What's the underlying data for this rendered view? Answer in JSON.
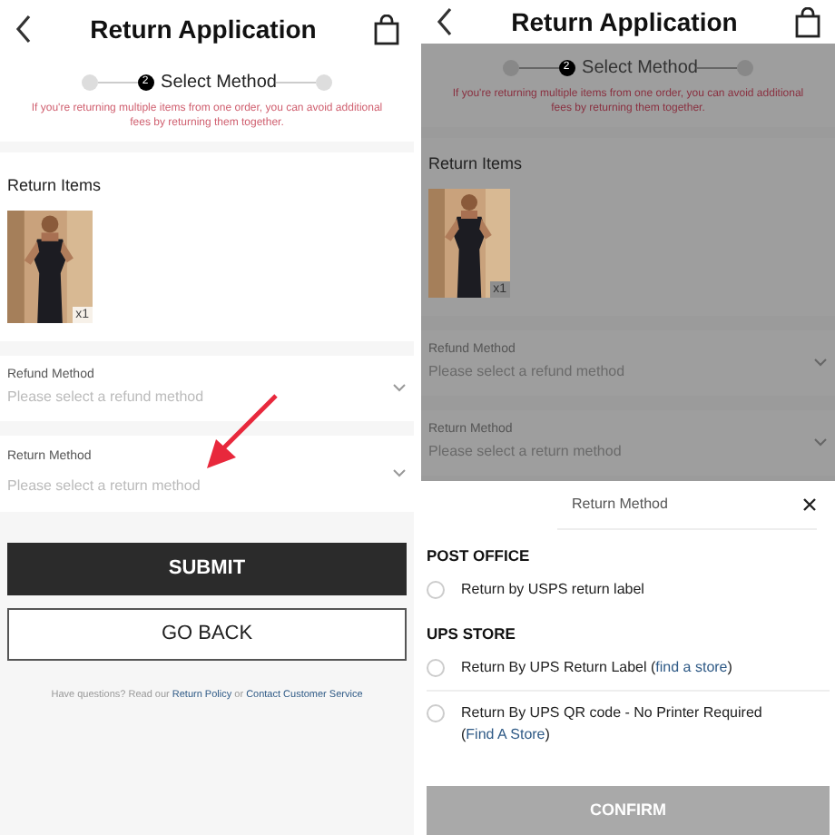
{
  "screens": [
    {
      "dimmed": false,
      "header": {
        "title": "Return Application"
      },
      "steps": [
        {
          "selected": false
        },
        {
          "number": "2",
          "label": "Select Method",
          "selected": true
        },
        {
          "selected": false
        }
      ],
      "notice": "If you're returning multiple items from one order, you can avoid additional fees by returning them together.",
      "items": {
        "heading": "Return Items",
        "products": [
          {
            "kind": "picture",
            "quantity": "x1"
          }
        ]
      },
      "fields": [
        {
          "label": "Refund Method",
          "placeholder": "Please select a refund method"
        },
        {
          "label": "Return Method",
          "placeholder": "Please select a return method"
        }
      ],
      "annotation_arrow": true,
      "buttons": [
        {
          "kind": "primary",
          "label": "SUBMIT"
        },
        {
          "kind": "outline",
          "label": "GO BACK"
        }
      ],
      "help": [
        {
          "kind": "text",
          "text": "Have questions? Read our "
        },
        {
          "kind": "link",
          "text": "Return Policy"
        },
        {
          "kind": "text",
          "text": " or "
        },
        {
          "kind": "link",
          "text": "Contact Customer Service"
        }
      ]
    },
    {
      "dimmed": true,
      "header": {
        "title": "Return Application"
      },
      "steps": [
        {
          "selected": false
        },
        {
          "number": "2",
          "label": "Select Method",
          "selected": true
        },
        {
          "selected": false
        }
      ],
      "notice": "If you're returning multiple items from one order, you can avoid additional fees by returning them together.",
      "items": {
        "heading": "Return Items",
        "products": [
          {
            "kind": "picture",
            "quantity": "x1"
          }
        ]
      },
      "fields": [
        {
          "label": "Refund Method",
          "placeholder": "Please select a refund method"
        },
        {
          "label": "Return Method",
          "placeholder": "Please select a return method"
        }
      ],
      "sheet": {
        "title": "Return Method",
        "groups": [
          {
            "heading": "POST OFFICE",
            "options": [
              {
                "parts": [
                  {
                    "kind": "text",
                    "text": "Return by USPS return label"
                  }
                ],
                "selected": false
              }
            ]
          },
          {
            "heading": "UPS STORE",
            "options": [
              {
                "parts": [
                  {
                    "kind": "text",
                    "text": "Return By UPS Return Label ("
                  },
                  {
                    "kind": "link",
                    "text": "find a store"
                  },
                  {
                    "kind": "text",
                    "text": ")"
                  }
                ],
                "selected": false
              },
              {
                "parts": [
                  {
                    "kind": "text",
                    "text": "Return By UPS QR code - No Printer Required ("
                  },
                  {
                    "kind": "link",
                    "text": "Find A Store"
                  },
                  {
                    "kind": "text",
                    "text": ")"
                  }
                ],
                "selected": false
              }
            ]
          }
        ],
        "confirm": {
          "label": "CONFIRM",
          "disabled": true
        }
      }
    }
  ]
}
